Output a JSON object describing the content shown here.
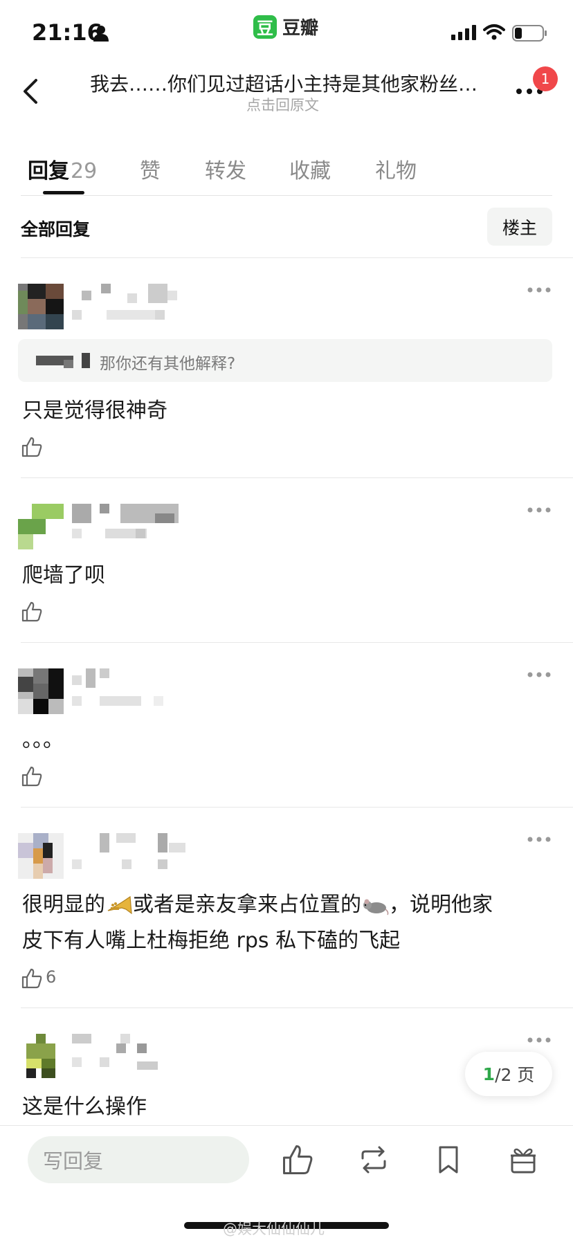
{
  "status_bar": {
    "time": "21:16"
  },
  "app": {
    "logo_char": "豆",
    "name": "豆瓣",
    "accent": "#2fbd49"
  },
  "nav": {
    "title": "我去……你们见过超话小主持是其他家粉丝的吗",
    "subtitle": "点击回原文",
    "notification_count": "1"
  },
  "tabs": [
    {
      "label": "回复",
      "count": "29",
      "active": true
    },
    {
      "label": "赞"
    },
    {
      "label": "转发"
    },
    {
      "label": "收藏"
    },
    {
      "label": "礼物"
    }
  ],
  "filter": {
    "title": "全部回复",
    "op_button": "楼主"
  },
  "comments": [
    {
      "quote": "那你还有其他解释?",
      "text": "只是觉得很神奇",
      "likes": ""
    },
    {
      "text": "爬墙了呗",
      "likes": ""
    },
    {
      "text": "。。。",
      "likes": ""
    },
    {
      "text_part1": "很明显的",
      "text_part2": "或者是亲友拿来占位置的",
      "text_part3": "，说明他家",
      "text_line2": "皮下有人嘴上杜梅拒绝 rps 私下磕的飞起",
      "likes": "6",
      "emoji_icons": [
        "trumpet-emoji",
        "rat-emoji"
      ]
    },
    {
      "text": "这是什么操作",
      "likes": ""
    }
  ],
  "pagination": {
    "current": "1",
    "total": "/2 页"
  },
  "bottom_bar": {
    "reply_placeholder": "写回复"
  },
  "watermark": "@娱大仙仙仙儿"
}
